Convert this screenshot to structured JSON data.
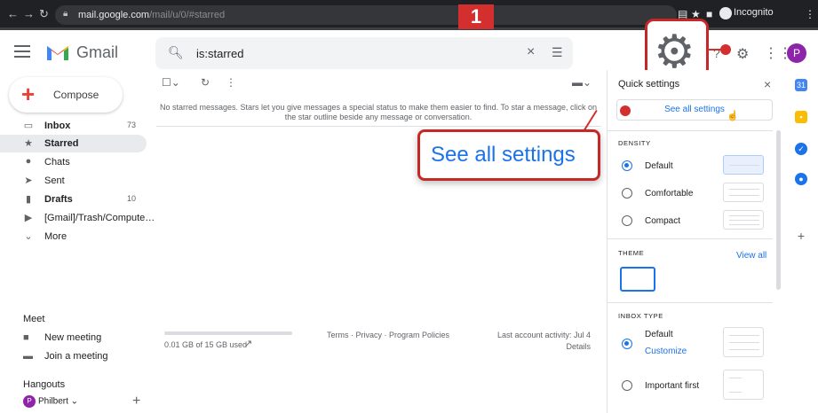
{
  "browser": {
    "url_main": "mail.google.com",
    "url_dim": "/mail/u/0/#starred",
    "incognito_label": "Incognito"
  },
  "header": {
    "brand": "Gmail",
    "search_value": "is:starred"
  },
  "step_badge": "1",
  "sidebar": {
    "compose_label": "Compose",
    "items": [
      {
        "label": "Inbox",
        "count": "73"
      },
      {
        "label": "Starred",
        "count": ""
      },
      {
        "label": "Chats",
        "count": ""
      },
      {
        "label": "Sent",
        "count": ""
      },
      {
        "label": "Drafts",
        "count": "10"
      },
      {
        "label": "[Gmail]/Trash/Compute…",
        "count": ""
      },
      {
        "label": "More",
        "count": ""
      }
    ],
    "meet_header": "Meet",
    "meet_items": [
      "New meeting",
      "Join a meeting"
    ],
    "hangouts_header": "Hangouts",
    "hangouts_user": "Philbert"
  },
  "main": {
    "empty_message": "No starred messages. Stars let you give messages a special status to make them easier to find. To star a message, click on the star outline beside any message or conversation.",
    "storage_text": "0.01 GB of 15 GB used",
    "footer_links": "Terms · Privacy · Program Policies",
    "last_activity": "Last account activity: Jul 4",
    "details": "Details"
  },
  "callout_text": "See all settings",
  "quick_settings": {
    "title": "Quick settings",
    "see_all": "See all settings",
    "density_header": "DENSITY",
    "density_options": [
      "Default",
      "Comfortable",
      "Compact"
    ],
    "theme_header": "THEME",
    "view_all": "View all",
    "inbox_type_header": "INBOX TYPE",
    "inbox_default": "Default",
    "customize": "Customize",
    "important_first": "Important first"
  },
  "colors": {
    "accent": "#1a73e8",
    "highlight": "#c62828",
    "avatar": "#8e24aa"
  }
}
